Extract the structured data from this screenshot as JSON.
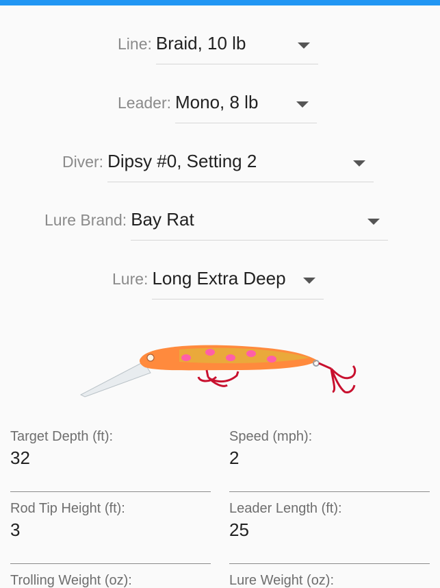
{
  "selectors": {
    "line": {
      "label": "Line:",
      "value": "Braid, 10 lb"
    },
    "leader": {
      "label": "Leader:",
      "value": "Mono, 8 lb"
    },
    "diver": {
      "label": "Diver:",
      "value": "Dipsy #0, Setting 2"
    },
    "lure_brand": {
      "label": "Lure Brand:",
      "value": "Bay Rat"
    },
    "lure": {
      "label": "Lure:",
      "value": "Long Extra Deep"
    }
  },
  "fields": {
    "target_depth": {
      "label": "Target Depth (ft):",
      "value": "32"
    },
    "speed": {
      "label": "Speed (mph):",
      "value": "2"
    },
    "rod_tip_height": {
      "label": "Rod Tip Height (ft):",
      "value": "3"
    },
    "leader_length": {
      "label": "Leader Length (ft):",
      "value": "25"
    },
    "trolling_weight": {
      "label": "Trolling Weight (oz):",
      "value": ""
    },
    "lure_weight": {
      "label": "Lure Weight (oz):",
      "value": ""
    }
  },
  "colors": {
    "accent": "#2196f3",
    "lure_body": "#ff8a3d",
    "lure_spots": "#ff5fa8",
    "hooks": "#c8102e"
  },
  "icons": {
    "dropdown": "caret-down-icon",
    "lure_image": "crankbait-lure-image"
  }
}
